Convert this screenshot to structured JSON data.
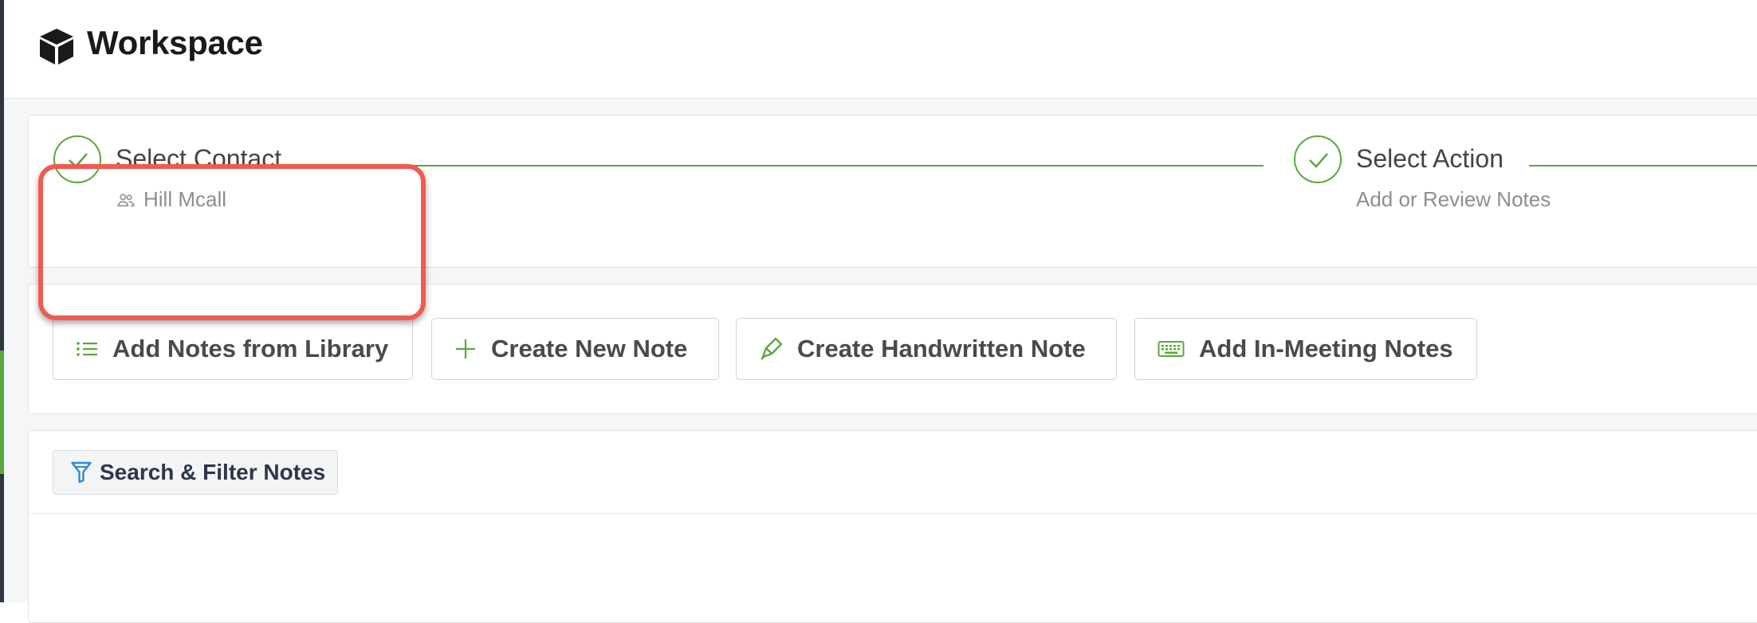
{
  "app": {
    "title": "Workspace",
    "logo_icon": "cube-icon"
  },
  "stepper": {
    "steps": [
      {
        "title": "Select Contact",
        "subtitle": "Hill Mcall",
        "subtitle_icon": "person-icon",
        "status": "complete"
      },
      {
        "title": "Select Action",
        "subtitle": "Add or Review Notes",
        "status": "complete"
      }
    ]
  },
  "actions": {
    "buttons": [
      {
        "label": "Add Notes from Library",
        "icon": "list-icon",
        "highlighted": true
      },
      {
        "label": "Create New Note",
        "icon": "plus-icon"
      },
      {
        "label": "Create Handwritten Note",
        "icon": "pen-icon"
      },
      {
        "label": "Add In-Meeting Notes",
        "icon": "keyboard-icon"
      }
    ]
  },
  "notes": {
    "filter_label": "Search & Filter Notes",
    "filter_icon": "funnel-icon"
  },
  "colors": {
    "accent_green": "#5aa83c",
    "highlight_red": "#f05a4f",
    "filter_blue": "#2b8ad6"
  }
}
